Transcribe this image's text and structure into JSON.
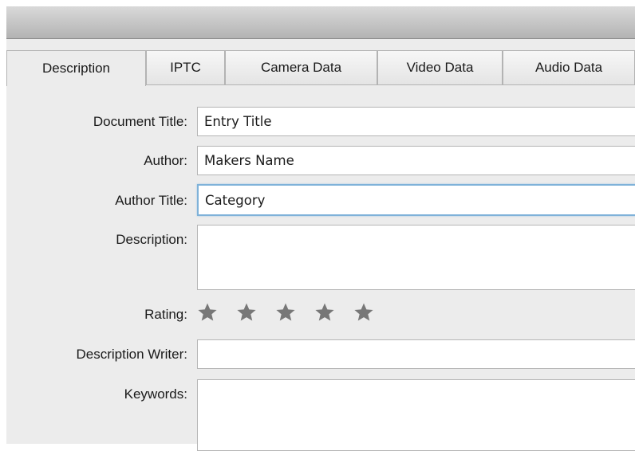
{
  "tabs": [
    {
      "label": "Description",
      "active": true
    },
    {
      "label": "IPTC",
      "active": false
    },
    {
      "label": "Camera Data",
      "active": false
    },
    {
      "label": "Video Data",
      "active": false
    },
    {
      "label": "Audio Data",
      "active": false
    }
  ],
  "form": {
    "document_title": {
      "label": "Document Title:",
      "value": "Entry Title"
    },
    "author": {
      "label": "Author:",
      "value": "Makers Name"
    },
    "author_title": {
      "label": "Author Title:",
      "value": "Category"
    },
    "description": {
      "label": "Description:",
      "value": ""
    },
    "rating": {
      "label": "Rating:",
      "value": 0,
      "max": 5
    },
    "description_writer": {
      "label": "Description Writer:",
      "value": ""
    },
    "keywords": {
      "label": "Keywords:",
      "value": ""
    }
  },
  "colors": {
    "star": "#777777",
    "focus_border": "#7fb2d9"
  }
}
